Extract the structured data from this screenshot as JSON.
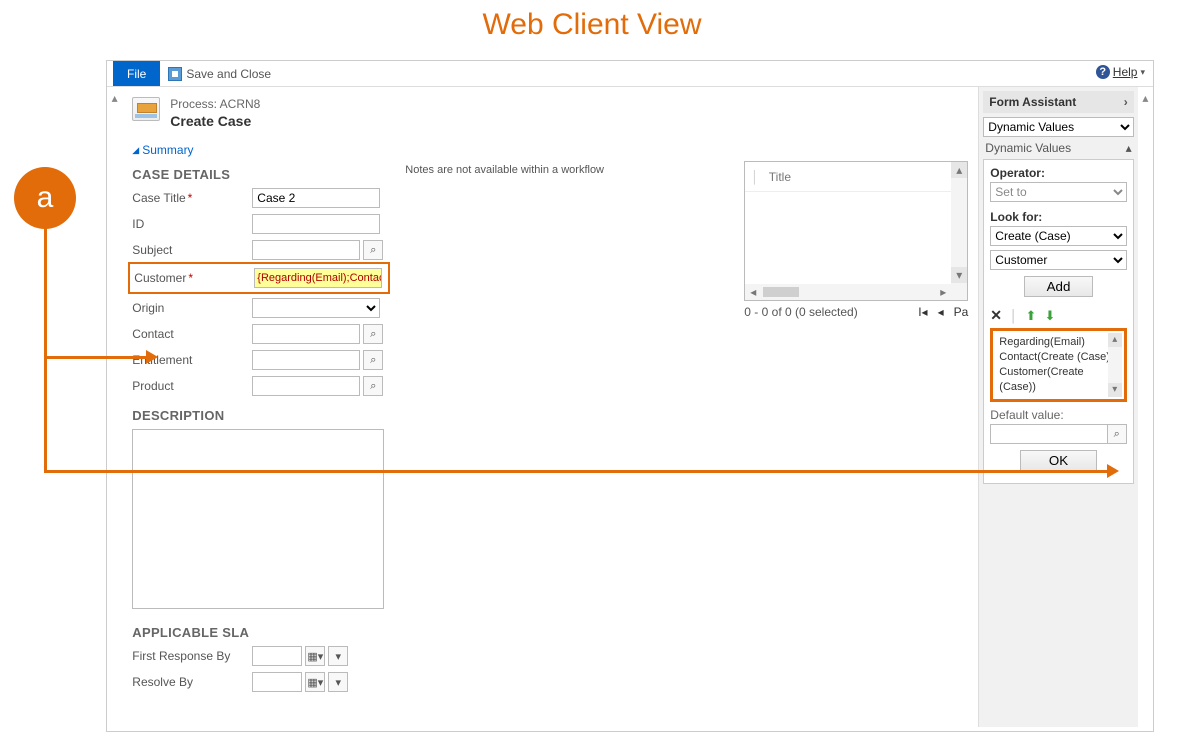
{
  "annotation": {
    "badge_letter": "a",
    "heading": "Web Client View"
  },
  "toolbar": {
    "file_label": "File",
    "save_close_label": "Save and Close",
    "help_label": "Help"
  },
  "header": {
    "process_prefix": "Process:",
    "process_name": "ACRN8",
    "page_title": "Create Case",
    "summary_label": "Summary"
  },
  "sections": {
    "case_details": "CASE DETAILS",
    "description": "DESCRIPTION",
    "applicable_sla": "APPLICABLE SLA"
  },
  "case_details_fields": {
    "case_title_label": "Case Title",
    "case_title_value": "Case 2",
    "id_label": "ID",
    "id_value": "",
    "subject_label": "Subject",
    "subject_value": "",
    "customer_label": "Customer",
    "customer_value": "{Regarding(Email);Contact(Cre",
    "origin_label": "Origin",
    "origin_value": "",
    "contact_label": "Contact",
    "contact_value": "",
    "entitlement_label": "Entitlement",
    "entitlement_value": "",
    "product_label": "Product",
    "product_value": ""
  },
  "notes_text": "Notes are not available within a workflow",
  "list": {
    "title_col": "Title",
    "footer": "0 - 0 of 0 (0 selected)",
    "page_label": "Pa"
  },
  "sla": {
    "first_label": "First Response By",
    "resolve_label": "Resolve By"
  },
  "form_assistant": {
    "header": "Form Assistant",
    "dynamic_values": "Dynamic Values",
    "operator_label": "Operator:",
    "operator_value": "Set to",
    "look_for_label": "Look for:",
    "look_for_1": "Create (Case)",
    "look_for_2": "Customer",
    "add_label": "Add",
    "dv_items": [
      "Regarding(Email)",
      "Contact(Create (Case))",
      "Customer(Create (Case))"
    ],
    "default_value_label": "Default value:",
    "ok_label": "OK"
  }
}
